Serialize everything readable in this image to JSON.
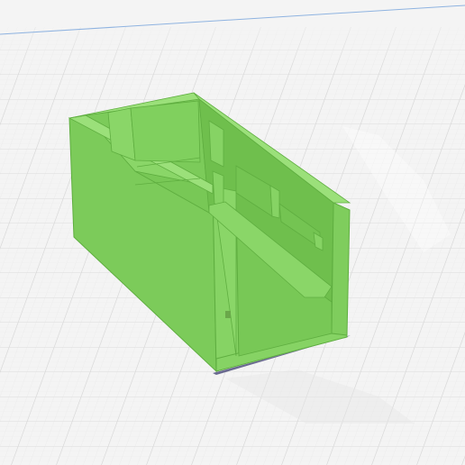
{
  "viewport": {
    "background_color": "#f4f4f4",
    "grid_major_color": "#d9d9d9",
    "grid_minor_color": "#ebebeb",
    "build_plate_edge_color": "#8fb3e0"
  },
  "model": {
    "face_color_light": "#8ad668",
    "face_color_mid": "#79c957",
    "face_color_dark": "#5fae40",
    "edge_color": "#4f9a33",
    "base_shadow_color": "#6a6a90"
  }
}
